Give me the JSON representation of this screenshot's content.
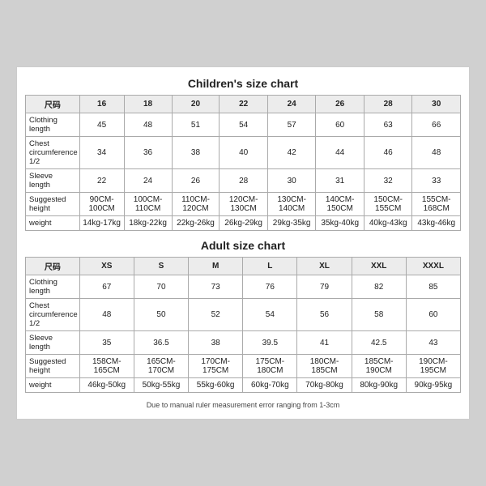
{
  "children_chart": {
    "title": "Children's size chart",
    "columns": [
      "尺码",
      "16",
      "18",
      "20",
      "22",
      "24",
      "26",
      "28",
      "30"
    ],
    "rows": [
      {
        "label": "Clothing\nlength",
        "values": [
          "45",
          "48",
          "51",
          "54",
          "57",
          "60",
          "63",
          "66"
        ]
      },
      {
        "label": "Chest\ncircumference\n1/2",
        "values": [
          "34",
          "36",
          "38",
          "40",
          "42",
          "44",
          "46",
          "48"
        ]
      },
      {
        "label": "Sleeve\nlength",
        "values": [
          "22",
          "24",
          "26",
          "28",
          "30",
          "31",
          "32",
          "33"
        ]
      },
      {
        "label": "Suggested\nheight",
        "values": [
          "90CM-100CM",
          "100CM-110CM",
          "110CM-120CM",
          "120CM-130CM",
          "130CM-140CM",
          "140CM-150CM",
          "150CM-155CM",
          "155CM-168CM"
        ]
      },
      {
        "label": "weight",
        "values": [
          "14kg-17kg",
          "18kg-22kg",
          "22kg-26kg",
          "26kg-29kg",
          "29kg-35kg",
          "35kg-40kg",
          "40kg-43kg",
          "43kg-46kg"
        ]
      }
    ]
  },
  "adult_chart": {
    "title": "Adult size chart",
    "columns": [
      "尺码",
      "XS",
      "S",
      "M",
      "L",
      "XL",
      "XXL",
      "XXXL"
    ],
    "rows": [
      {
        "label": "Clothing\nlength",
        "values": [
          "67",
          "70",
          "73",
          "76",
          "79",
          "82",
          "85"
        ]
      },
      {
        "label": "Chest\ncircumference\n1/2",
        "values": [
          "48",
          "50",
          "52",
          "54",
          "56",
          "58",
          "60"
        ]
      },
      {
        "label": "Sleeve\nlength",
        "values": [
          "35",
          "36.5",
          "38",
          "39.5",
          "41",
          "42.5",
          "43"
        ]
      },
      {
        "label": "Suggested\nheight",
        "values": [
          "158CM-165CM",
          "165CM-170CM",
          "170CM-175CM",
          "175CM-180CM",
          "180CM-185CM",
          "185CM-190CM",
          "190CM-195CM"
        ]
      },
      {
        "label": "weight",
        "values": [
          "46kg-50kg",
          "50kg-55kg",
          "55kg-60kg",
          "60kg-70kg",
          "70kg-80kg",
          "80kg-90kg",
          "90kg-95kg"
        ]
      }
    ]
  },
  "note": "Due to manual ruler measurement error ranging from 1-3cm"
}
